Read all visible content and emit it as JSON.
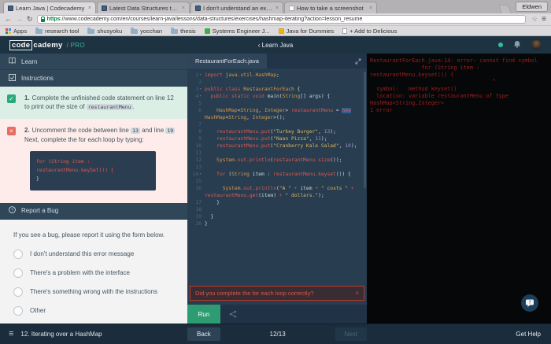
{
  "icons": {
    "close": "×",
    "hamburger": "≡",
    "star": "☆",
    "back": "←",
    "forward": "→",
    "reload": "↻",
    "fold": "▾",
    "nav_back": "‹"
  },
  "colors": {
    "accent_teal": "#3db38e",
    "run_green": "#2e9c72",
    "error_red": "#df5449",
    "console_red": "#9e1f1f"
  },
  "browser": {
    "tabs": [
      {
        "title": "Learn Java | Codecademy",
        "icon": "codecademy-favicon",
        "active": true
      },
      {
        "title": "Latest Data Structures top...",
        "icon": "codecademy-favicon",
        "active": false
      },
      {
        "title": "I don't understand an exe...",
        "icon": "codecademy-favicon",
        "active": false
      },
      {
        "title": "How to take a screenshot",
        "icon": "page-favicon",
        "active": false
      }
    ],
    "profile_button": "Eldwen",
    "url_scheme": "https",
    "url_rest": "://www.codecademy.com/en/courses/learn-java/lessons/data-structures/exercises/hashmap-iterating?action=lesson_resume",
    "bookmarks": [
      {
        "label": "Apps",
        "icon": "apps-grid-icon"
      },
      {
        "label": "research tool",
        "icon": "folder-icon"
      },
      {
        "label": "shusyoku",
        "icon": "folder-icon"
      },
      {
        "label": "yocchan",
        "icon": "folder-icon"
      },
      {
        "label": "thesis",
        "icon": "folder-icon"
      },
      {
        "label": "Systems Engineer J...",
        "icon": "green-app-icon"
      },
      {
        "label": "Java for Dummies",
        "icon": "java-book-icon"
      },
      {
        "label": "+ Add to Delicious",
        "icon": "page-icon"
      }
    ]
  },
  "header": {
    "logo_code": "code",
    "logo_rest": "cademy",
    "logo_pro": "/ PRO",
    "nav_back": "‹ ",
    "nav_title": "Learn Java"
  },
  "sidebar": {
    "learn_label": "Learn",
    "instructions_label": "Instructions",
    "task1": {
      "num": "1.",
      "before": "Complete the unfinished code statement on line 12 to print out the size of ",
      "chip": "restaurantMenu",
      "after": "."
    },
    "task2": {
      "num": "2.",
      "before": "Uncomment the code between line ",
      "chip1": "13",
      "mid": " and line ",
      "chip2": "19",
      "after": " Next, complete the for each loop by typing:",
      "code": [
        {
          "cls": "red",
          "text": "for (String item : restaurantMenu.keySet()) {"
        },
        {
          "cls": "plain",
          "text": " "
        },
        {
          "cls": "plain",
          "text": "}"
        }
      ]
    },
    "report_bug_label": "Report a Bug",
    "bug_intro": "If you see a bug, please report it using the form below.",
    "bug_options": [
      "I don't understand this error message",
      "There's a problem with the interface",
      "There's something wrong with the instructions",
      "Other"
    ]
  },
  "editor": {
    "filename": "RestaurantForEach.java",
    "error_banner": "Did you complete the for each loop correctly?",
    "run_label": "Run",
    "lines": [
      {
        "n": "1",
        "f": true,
        "t": [
          [
            "k",
            "import"
          ],
          [
            "p",
            " "
          ],
          [
            "ty",
            "java.util.HashMap"
          ],
          [
            "p",
            ";"
          ]
        ]
      },
      {
        "n": "2",
        "t": []
      },
      {
        "n": "3",
        "f": true,
        "t": [
          [
            "k",
            "public class"
          ],
          [
            "p",
            " "
          ],
          [
            "ty",
            "RestaurantForEach"
          ],
          [
            "p",
            " {"
          ]
        ]
      },
      {
        "n": "4",
        "f": true,
        "t": [
          [
            "p",
            "  "
          ],
          [
            "k",
            "public static void"
          ],
          [
            "p",
            " main("
          ],
          [
            "ty",
            "String"
          ],
          [
            "p",
            "[] args) {"
          ]
        ]
      },
      {
        "n": "5",
        "t": []
      },
      {
        "n": "6",
        "t": [
          [
            "p",
            "    "
          ],
          [
            "ty",
            "HashMap"
          ],
          [
            "p",
            "<"
          ],
          [
            "ty",
            "String"
          ],
          [
            "p",
            ", "
          ],
          [
            "ty",
            "Integer"
          ],
          [
            "p",
            "> "
          ],
          [
            "id",
            "restaurantMenu"
          ],
          [
            "p",
            " = "
          ],
          [
            "k hl",
            "new"
          ],
          [
            "p",
            " "
          ],
          [
            "ty",
            "HashMap"
          ],
          [
            "p",
            "<"
          ],
          [
            "ty",
            "String"
          ],
          [
            "p",
            ", "
          ],
          [
            "ty",
            "Integer"
          ],
          [
            "p",
            ">();"
          ]
        ]
      },
      {
        "n": "7",
        "t": []
      },
      {
        "n": "8",
        "t": [
          [
            "p",
            "    "
          ],
          [
            "id",
            "restaurantMenu.put"
          ],
          [
            "p",
            "("
          ],
          [
            "s",
            "\"Turkey Burger\""
          ],
          [
            "p",
            ", "
          ],
          [
            "nu",
            "13"
          ],
          [
            "p",
            ");"
          ]
        ]
      },
      {
        "n": "9",
        "t": [
          [
            "p",
            "    "
          ],
          [
            "id",
            "restaurantMenu.put"
          ],
          [
            "p",
            "("
          ],
          [
            "s",
            "\"Naan Pizza\""
          ],
          [
            "p",
            ", "
          ],
          [
            "nu",
            "11"
          ],
          [
            "p",
            ");"
          ]
        ]
      },
      {
        "n": "10",
        "t": [
          [
            "p",
            "    "
          ],
          [
            "id",
            "restaurantMenu.put"
          ],
          [
            "p",
            "("
          ],
          [
            "s",
            "\"Cranberry Kale Salad\""
          ],
          [
            "p",
            ", "
          ],
          [
            "nu",
            "10"
          ],
          [
            "p",
            ");"
          ]
        ]
      },
      {
        "n": "11",
        "t": []
      },
      {
        "n": "12",
        "t": [
          [
            "p",
            "    "
          ],
          [
            "ty",
            "System"
          ],
          [
            "id",
            ".out.println"
          ],
          [
            "p",
            "("
          ],
          [
            "id",
            "restaurantMenu.size"
          ],
          [
            "p",
            "());"
          ]
        ]
      },
      {
        "n": "13",
        "t": []
      },
      {
        "n": "14",
        "f": true,
        "t": [
          [
            "p",
            "    "
          ],
          [
            "k",
            "for"
          ],
          [
            "p",
            " ("
          ],
          [
            "ty",
            "String"
          ],
          [
            "p",
            " item : "
          ],
          [
            "id",
            "restaurantMenu.keyset"
          ],
          [
            "p",
            "()) {"
          ]
        ]
      },
      {
        "n": "15",
        "t": []
      },
      {
        "n": "16",
        "t": [
          [
            "p",
            "      "
          ],
          [
            "ty",
            "System"
          ],
          [
            "id",
            ".out.println"
          ],
          [
            "p",
            "("
          ],
          [
            "s",
            "\"A \""
          ],
          [
            "p",
            " "
          ],
          [
            "k",
            "+"
          ],
          [
            "p",
            " item "
          ],
          [
            "k",
            "+"
          ],
          [
            "p",
            " "
          ],
          [
            "s",
            "\" costs \""
          ],
          [
            "p",
            " "
          ],
          [
            "k",
            "+"
          ],
          [
            "p",
            " "
          ],
          [
            "id",
            "restaurantMenu.get"
          ],
          [
            "p",
            "(item) "
          ],
          [
            "k",
            "+"
          ],
          [
            "p",
            " "
          ],
          [
            "s",
            "\" dollars.\""
          ],
          [
            "p",
            ");"
          ]
        ]
      },
      {
        "n": "17",
        "t": [
          [
            "p",
            "    }"
          ]
        ]
      },
      {
        "n": "18",
        "t": []
      },
      {
        "n": "19",
        "t": [
          [
            "p",
            "  }"
          ]
        ]
      },
      {
        "n": "20",
        "t": [
          [
            "p",
            "}"
          ]
        ]
      }
    ]
  },
  "console": {
    "lines": [
      "RestaurantForEach.java:14: error: cannot find symbol",
      "                for (String item :",
      "restaurantMenu.keyset()) {",
      "                                      ^",
      "  symbol:   method keyset()",
      "  location: variable restaurantMenu of type",
      "HashMap<String,Integer>",
      "1 error"
    ]
  },
  "footer": {
    "lesson": "12. Iterating over a HashMap",
    "back_label": "Back",
    "progress": "12/13",
    "next_label": "Next",
    "get_help_label": "Get Help"
  }
}
